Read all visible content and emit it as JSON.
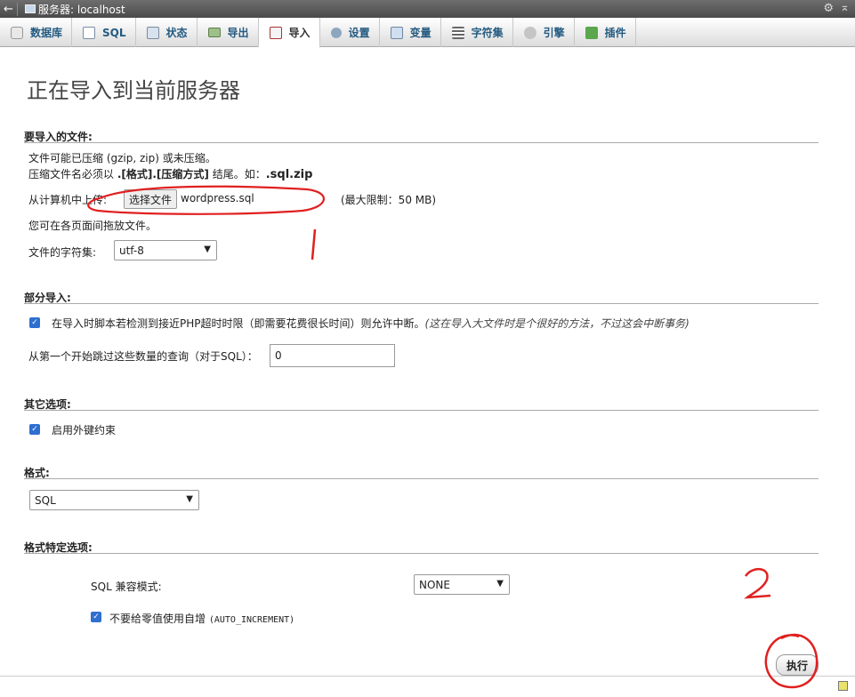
{
  "titlebar": {
    "back": "←",
    "title": "服务器: localhost"
  },
  "tabs": [
    {
      "label": "数据库",
      "icon": "database-icon"
    },
    {
      "label": "SQL",
      "icon": "sql-icon"
    },
    {
      "label": "状态",
      "icon": "status-icon"
    },
    {
      "label": "导出",
      "icon": "export-icon"
    },
    {
      "label": "导入",
      "icon": "import-icon",
      "active": true
    },
    {
      "label": "设置",
      "icon": "settings-icon"
    },
    {
      "label": "变量",
      "icon": "variables-icon"
    },
    {
      "label": "字符集",
      "icon": "charset-icon"
    },
    {
      "label": "引擎",
      "icon": "engine-icon"
    },
    {
      "label": "插件",
      "icon": "plugin-icon"
    }
  ],
  "page_title": "正在导入到当前服务器",
  "file_section": {
    "heading": "要导入的文件:",
    "line1": "文件可能已压缩 (gzip, zip) 或未压缩。",
    "line2_prefix": "压缩文件名必须以 ",
    "line2_bold": ".[格式].[压缩方式]",
    "line2_mid": " 结尾。如：",
    "line2_example": ".sql.zip",
    "upload_label": "从计算机中上传:",
    "choose_button": "选择文件",
    "file_name": "wordpress.sql",
    "max_limit": "(最大限制：50 MB)",
    "drag_hint": "您可在各页面间拖放文件。",
    "charset_label": "文件的字符集:",
    "charset_value": "utf-8"
  },
  "partial_section": {
    "heading": "部分导入:",
    "interrupt_label": "在导入时脚本若检测到接近PHP超时时限（即需要花费很长时间）则允许中断。",
    "interrupt_note": "(这在导入大文件时是个很好的方法，不过这会中断事务)",
    "interrupt_checked": true,
    "skip_label": "从第一个开始跳过这些数量的查询（对于SQL）：",
    "skip_value": "0"
  },
  "other_section": {
    "heading": "其它选项:",
    "fk_label": "启用外键约束",
    "fk_checked": true
  },
  "format_section": {
    "heading": "格式:",
    "format_value": "SQL"
  },
  "format_options_section": {
    "heading": "格式特定选项:",
    "compat_label": "SQL 兼容模式:",
    "compat_value": "NONE",
    "auto_inc_label": "不要给零值使用自增",
    "auto_inc_code": "(AUTO_INCREMENT)",
    "auto_inc_checked": true
  },
  "go_button": "执行",
  "annotations": {
    "mark1": "1",
    "mark2": "2",
    "color": "#e02020"
  },
  "colors": {
    "accent": "#235a81",
    "checkbox": "#2f6fcf"
  }
}
